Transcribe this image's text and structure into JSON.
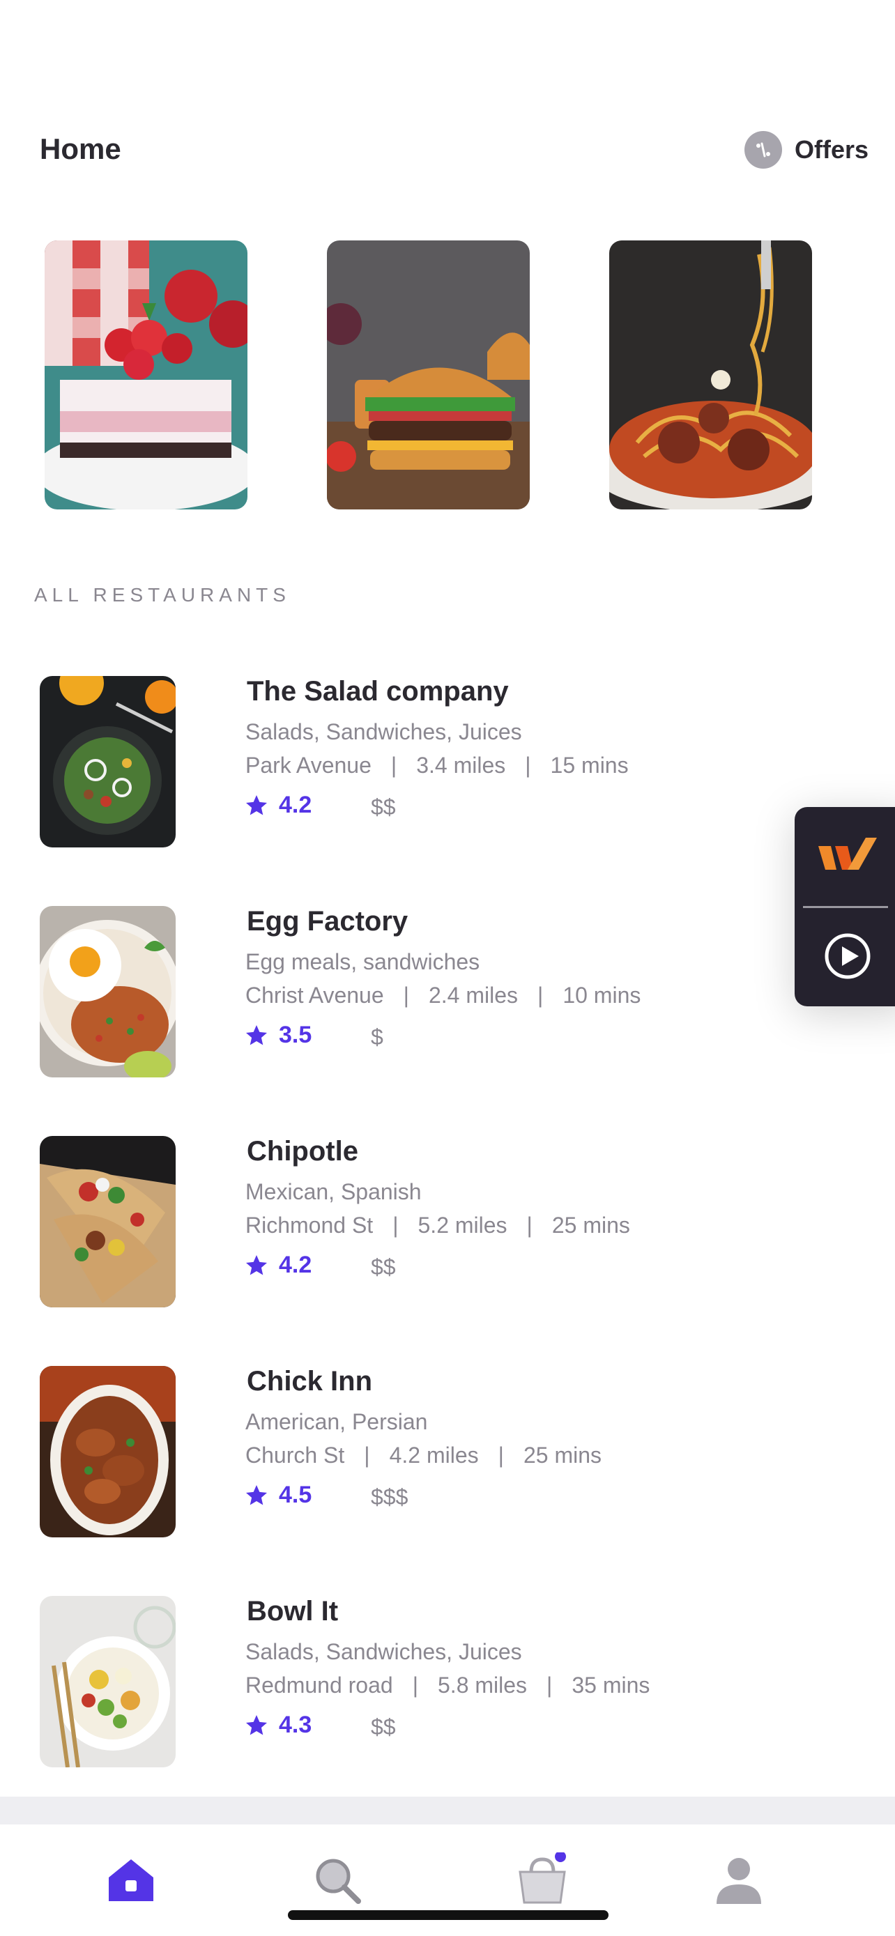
{
  "header": {
    "title": "Home",
    "offers_label": "Offers"
  },
  "featured": [
    {
      "icon": "strawberry-dessert-image"
    },
    {
      "icon": "burger-image"
    },
    {
      "icon": "spaghetti-meatballs-image"
    }
  ],
  "section_label": "ALL RESTAURANTS",
  "restaurants": [
    {
      "name": "The Salad company",
      "cuisine": "Salads, Sandwiches, Juices",
      "location": "Park Avenue",
      "distance": "3.4 miles",
      "time": "15 mins",
      "rating": "4.2",
      "price": "$$"
    },
    {
      "name": "Egg Factory",
      "cuisine": "Egg meals, sandwiches",
      "location": "Christ Avenue",
      "distance": "2.4 miles",
      "time": "10 mins",
      "rating": "3.5",
      "price": "$"
    },
    {
      "name": "Chipotle",
      "cuisine": "Mexican, Spanish",
      "location": "Richmond St",
      "distance": "5.2 miles",
      "time": "25 mins",
      "rating": "4.2",
      "price": "$$"
    },
    {
      "name": "Chick Inn",
      "cuisine": "American, Persian",
      "location": "Church St",
      "distance": "4.2 miles",
      "time": "25 mins",
      "rating": "4.5",
      "price": "$$$"
    },
    {
      "name": "Bowl It",
      "cuisine": "Salads, Sandwiches, Juices",
      "location": "Redmund road",
      "distance": "5.8 miles",
      "time": "35 mins",
      "rating": "4.3",
      "price": "$$"
    }
  ],
  "meta_separator": "|",
  "colors": {
    "accent": "#5434e6",
    "text": "#2b2930",
    "muted": "#8a8790",
    "panel": "#25222e"
  },
  "tabs": [
    {
      "icon": "home-icon",
      "active": true
    },
    {
      "icon": "search-icon",
      "active": false
    },
    {
      "icon": "cart-icon",
      "active": false
    },
    {
      "icon": "profile-icon",
      "active": false
    }
  ]
}
